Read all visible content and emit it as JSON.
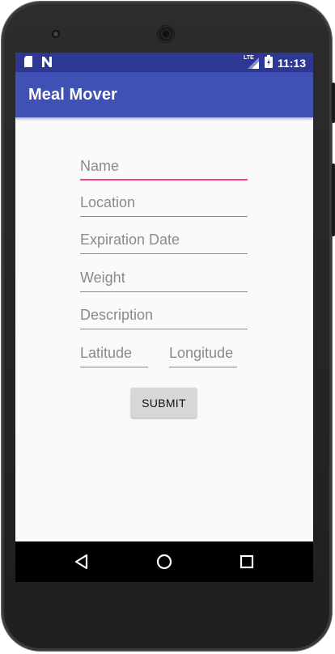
{
  "status_bar": {
    "time": "11:13",
    "network": "LTE",
    "icons": [
      "sd-card-icon",
      "n-notification-icon",
      "lte-signal-icon",
      "battery-icon"
    ]
  },
  "app_bar": {
    "title": "Meal Mover"
  },
  "form": {
    "name_placeholder": "Name",
    "location_placeholder": "Location",
    "expiration_placeholder": "Expiration Date",
    "weight_placeholder": "Weight",
    "description_placeholder": "Description",
    "latitude_placeholder": "Latitude",
    "longitude_placeholder": "Longitude",
    "submit_label": "SUBMIT"
  },
  "nav_bar": {
    "icons": [
      "back-icon",
      "home-icon",
      "recents-icon"
    ]
  },
  "colors": {
    "primary": "#3f51b5",
    "primary_dark": "#2c3893",
    "accent": "#ff4081",
    "background": "#fafafa"
  }
}
